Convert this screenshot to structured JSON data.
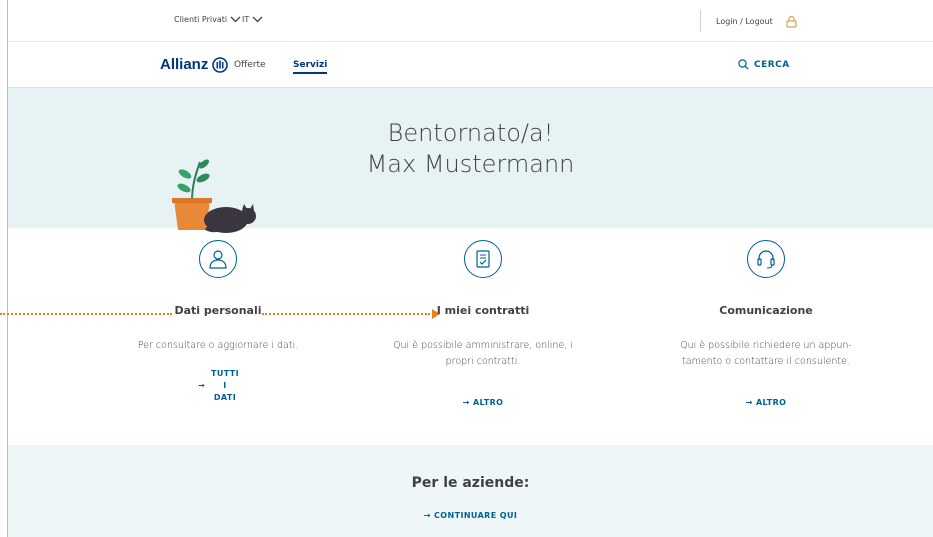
{
  "topbar": {
    "segment": "Clienti Privati",
    "language": "IT",
    "login": "Login / Logout"
  },
  "nav": {
    "logo": "Allianz",
    "offers": "Offerte",
    "services": "Servizi",
    "search": "CERCA"
  },
  "hero": {
    "greeting": "Bentornato/a!",
    "name": "Max Mustermann"
  },
  "services": [
    {
      "title": "Dati personali",
      "desc_line1": "Per consultare o aggiornare i dati.",
      "desc_line2": "",
      "link_lines": [
        "TUTTI",
        "I",
        "DATI"
      ],
      "link_arrow": "→"
    },
    {
      "title": "I miei contratti",
      "desc_line1": "Qui è possibile amministrare, online, i",
      "desc_line2": "propri contratti.",
      "link": "→ ALTRO"
    },
    {
      "title": "Comunicazione",
      "desc_line1": "Qui è possibile richiedere un appun-",
      "desc_line2": "tamento o contattare il consulente.",
      "link": "→ ALTRO"
    }
  ],
  "companies": {
    "title": "Per le aziende:",
    "link": "→  CONTINUARE QUI"
  },
  "colors": {
    "brand": "#003781",
    "accent": "#006192",
    "hero_bg": "#e6f2f3",
    "tracker": "#e67e22"
  },
  "icons": [
    "chevron-down-icon",
    "lock-icon",
    "search-icon",
    "person-icon",
    "contract-icon",
    "headset-icon"
  ]
}
